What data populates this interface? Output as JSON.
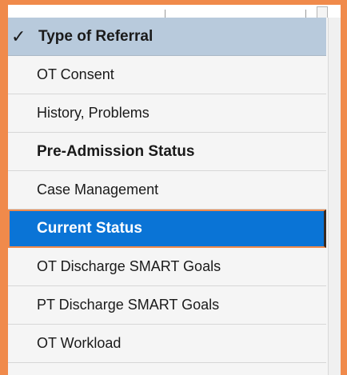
{
  "menu": {
    "header": {
      "check": "✓",
      "label": "Type of Referral"
    },
    "items": [
      {
        "label": "OT Consent"
      },
      {
        "label": "History, Problems"
      },
      {
        "label": "Pre-Admission Status"
      },
      {
        "label": "Case Management"
      },
      {
        "label": "Current Status"
      },
      {
        "label": "OT Discharge SMART Goals"
      },
      {
        "label": "PT Discharge SMART Goals"
      },
      {
        "label": "OT Workload"
      }
    ],
    "selected_index": 4
  },
  "colors": {
    "frame_accent": "#f08a4b",
    "header_bg": "#b8cadc",
    "selected_bg": "#0a74d6",
    "list_bg": "#f5f5f5"
  }
}
